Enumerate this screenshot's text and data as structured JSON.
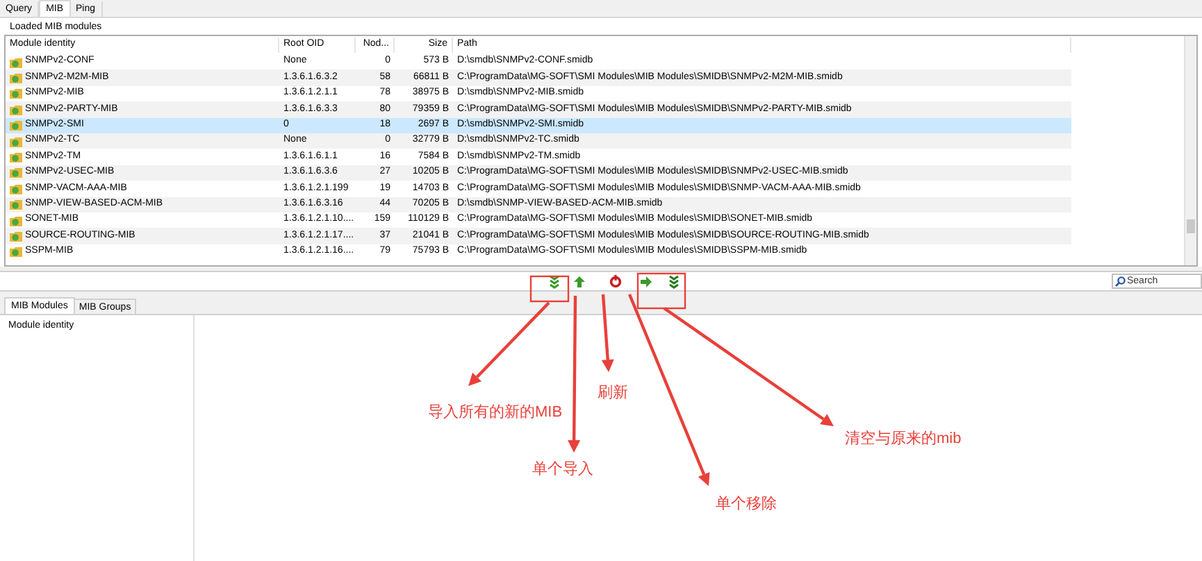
{
  "tabs": [
    {
      "label": "Query",
      "selected": false
    },
    {
      "label": "MIB",
      "selected": true
    },
    {
      "label": "Ping",
      "selected": false
    }
  ],
  "group_title": "Loaded MIB modules",
  "table": {
    "columns": [
      "Module identity",
      "Root OID",
      "Nod...",
      "Size",
      "Path"
    ],
    "rows": [
      {
        "cells": [
          "SNMPv2-CONF",
          "None",
          "0",
          "573 B",
          "D:\\smdb\\SNMPv2-CONF.smidb"
        ],
        "selected": false
      },
      {
        "cells": [
          "SNMPv2-M2M-MIB",
          "1.3.6.1.6.3.2",
          "58",
          "66811 B",
          "C:\\ProgramData\\MG-SOFT\\SMI Modules\\MIB Modules\\SMIDB\\SNMPv2-M2M-MIB.smidb"
        ],
        "selected": false
      },
      {
        "cells": [
          "SNMPv2-MIB",
          "1.3.6.1.2.1.1",
          "78",
          "38975 B",
          "D:\\smdb\\SNMPv2-MIB.smidb"
        ],
        "selected": false
      },
      {
        "cells": [
          "SNMPv2-PARTY-MIB",
          "1.3.6.1.6.3.3",
          "80",
          "79359 B",
          "C:\\ProgramData\\MG-SOFT\\SMI Modules\\MIB Modules\\SMIDB\\SNMPv2-PARTY-MIB.smidb"
        ],
        "selected": false
      },
      {
        "cells": [
          "SNMPv2-SMI",
          "0",
          "18",
          "2697 B",
          "D:\\smdb\\SNMPv2-SMI.smidb"
        ],
        "selected": true
      },
      {
        "cells": [
          "SNMPv2-TC",
          "None",
          "0",
          "32779 B",
          "D:\\smdb\\SNMPv2-TC.smidb"
        ],
        "selected": false
      },
      {
        "cells": [
          "SNMPv2-TM",
          "1.3.6.1.6.1.1",
          "16",
          "7584 B",
          "D:\\smdb\\SNMPv2-TM.smidb"
        ],
        "selected": false
      },
      {
        "cells": [
          "SNMPv2-USEC-MIB",
          "1.3.6.1.6.3.6",
          "27",
          "10205 B",
          "C:\\ProgramData\\MG-SOFT\\SMI Modules\\MIB Modules\\SMIDB\\SNMPv2-USEC-MIB.smidb"
        ],
        "selected": false
      },
      {
        "cells": [
          "SNMP-VACM-AAA-MIB",
          "1.3.6.1.2.1.199",
          "19",
          "14703 B",
          "C:\\ProgramData\\MG-SOFT\\SMI Modules\\MIB Modules\\SMIDB\\SNMP-VACM-AAA-MIB.smidb"
        ],
        "selected": false
      },
      {
        "cells": [
          "SNMP-VIEW-BASED-ACM-MIB",
          "1.3.6.1.6.3.16",
          "44",
          "70205 B",
          "D:\\smdb\\SNMP-VIEW-BASED-ACM-MIB.smidb"
        ],
        "selected": false
      },
      {
        "cells": [
          "SONET-MIB",
          "1.3.6.1.2.1.10....",
          "159",
          "110129 B",
          "C:\\ProgramData\\MG-SOFT\\SMI Modules\\MIB Modules\\SMIDB\\SONET-MIB.smidb"
        ],
        "selected": false
      },
      {
        "cells": [
          "SOURCE-ROUTING-MIB",
          "1.3.6.1.2.1.17....",
          "37",
          "21041 B",
          "C:\\ProgramData\\MG-SOFT\\SMI Modules\\MIB Modules\\SMIDB\\SOURCE-ROUTING-MIB.smidb"
        ],
        "selected": false
      },
      {
        "cells": [
          "SSPM-MIB",
          "1.3.6.1.2.1.16....",
          "79",
          "75793 B",
          "C:\\ProgramData\\MG-SOFT\\SMI Modules\\MIB Modules\\SMIDB\\SSPM-MIB.smidb"
        ],
        "selected": false
      }
    ]
  },
  "toolbar": [
    {
      "kind": "import-all"
    },
    {
      "kind": "import"
    },
    {
      "kind": "refresh"
    },
    {
      "kind": "remove"
    },
    {
      "kind": "clear"
    }
  ],
  "search": {
    "placeholder": "Search"
  },
  "bottom_tabs": [
    {
      "label": "MIB Modules",
      "selected": true
    },
    {
      "label": "MIB Groups",
      "selected": false
    }
  ],
  "bottom_table": {
    "columns": [
      "Module identity"
    ]
  },
  "annotations": [
    {
      "text": "导入所有的新的MIB"
    },
    {
      "text": "单个导入"
    },
    {
      "text": "刷新"
    },
    {
      "text": "单个移除"
    },
    {
      "text": "清空与原来的mib"
    }
  ]
}
